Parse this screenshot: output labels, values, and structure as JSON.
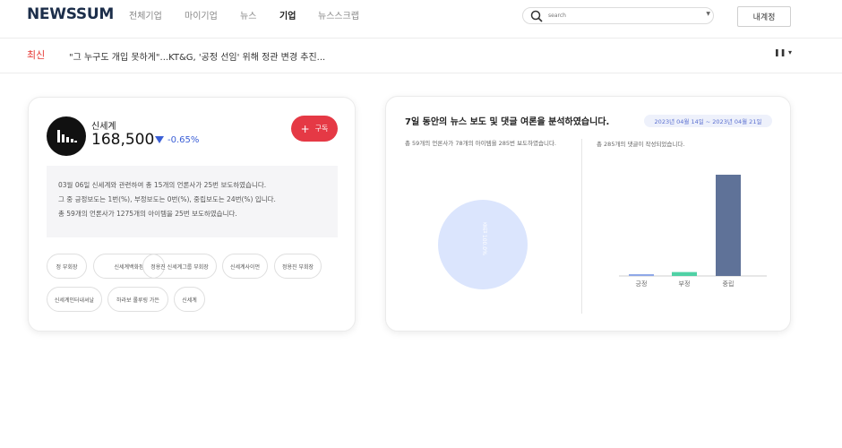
{
  "header": {
    "logo": "NEWSSUM",
    "nav": [
      "전체기업",
      "마이기업",
      "뉴스",
      "기업",
      "뉴스스크랩"
    ],
    "active_nav": "기업",
    "search_placeholder": "search",
    "account_button": "내계정"
  },
  "ticker": {
    "label": "최신",
    "headline": "\"그 누구도 개입 못하게\"...KT&G, '공정 선임' 위해 정관 변경 추진..."
  },
  "company": {
    "name": "신세계",
    "price": "168,500",
    "change": "-0.65%",
    "change_direction": "down",
    "change_color": "#3b5fd6",
    "subscribe_label": "구독",
    "summary_lines": [
      "03월 06일 신세계와 관련하여 총 15개의 언론사가 25번 보도하였습니다.",
      "그 중 긍정보도는 1번(%), 부정보도는 0번(%), 중립보도는 24번(%) 입니다.",
      "총 59개의 언론사가 1275개의 아이템을 25번 보도하였습니다."
    ],
    "tags": [
      "정 부회장",
      "신세계백화점",
      "정용진 신세계그룹 부회장",
      "신세계사이먼",
      "정용진 부회장",
      "신세계인터내셔날",
      "하라보 롤루링 가든",
      "신세계"
    ]
  },
  "analysis": {
    "title": "7일 동안의 뉴스 보도 및 댓글 여론을 분석하였습니다.",
    "date_range": "2023년 04월 14일 ~ 2023년 04월 21일",
    "left_caption": "총 59개의 언론사가 78개의 아이템을 285번 보도하였습니다.",
    "right_caption": "총 285개의 댓글이 작성되었습니다.",
    "pie_label": "중립 100.0%"
  },
  "chart_data": {
    "type": "bar",
    "categories": [
      "긍정",
      "부정",
      "중립"
    ],
    "values": [
      3,
      11,
      285
    ],
    "colors": [
      "#8fa8e8",
      "#4fd1a5",
      "#5f7298"
    ],
    "ylim": [
      0,
      290
    ]
  }
}
